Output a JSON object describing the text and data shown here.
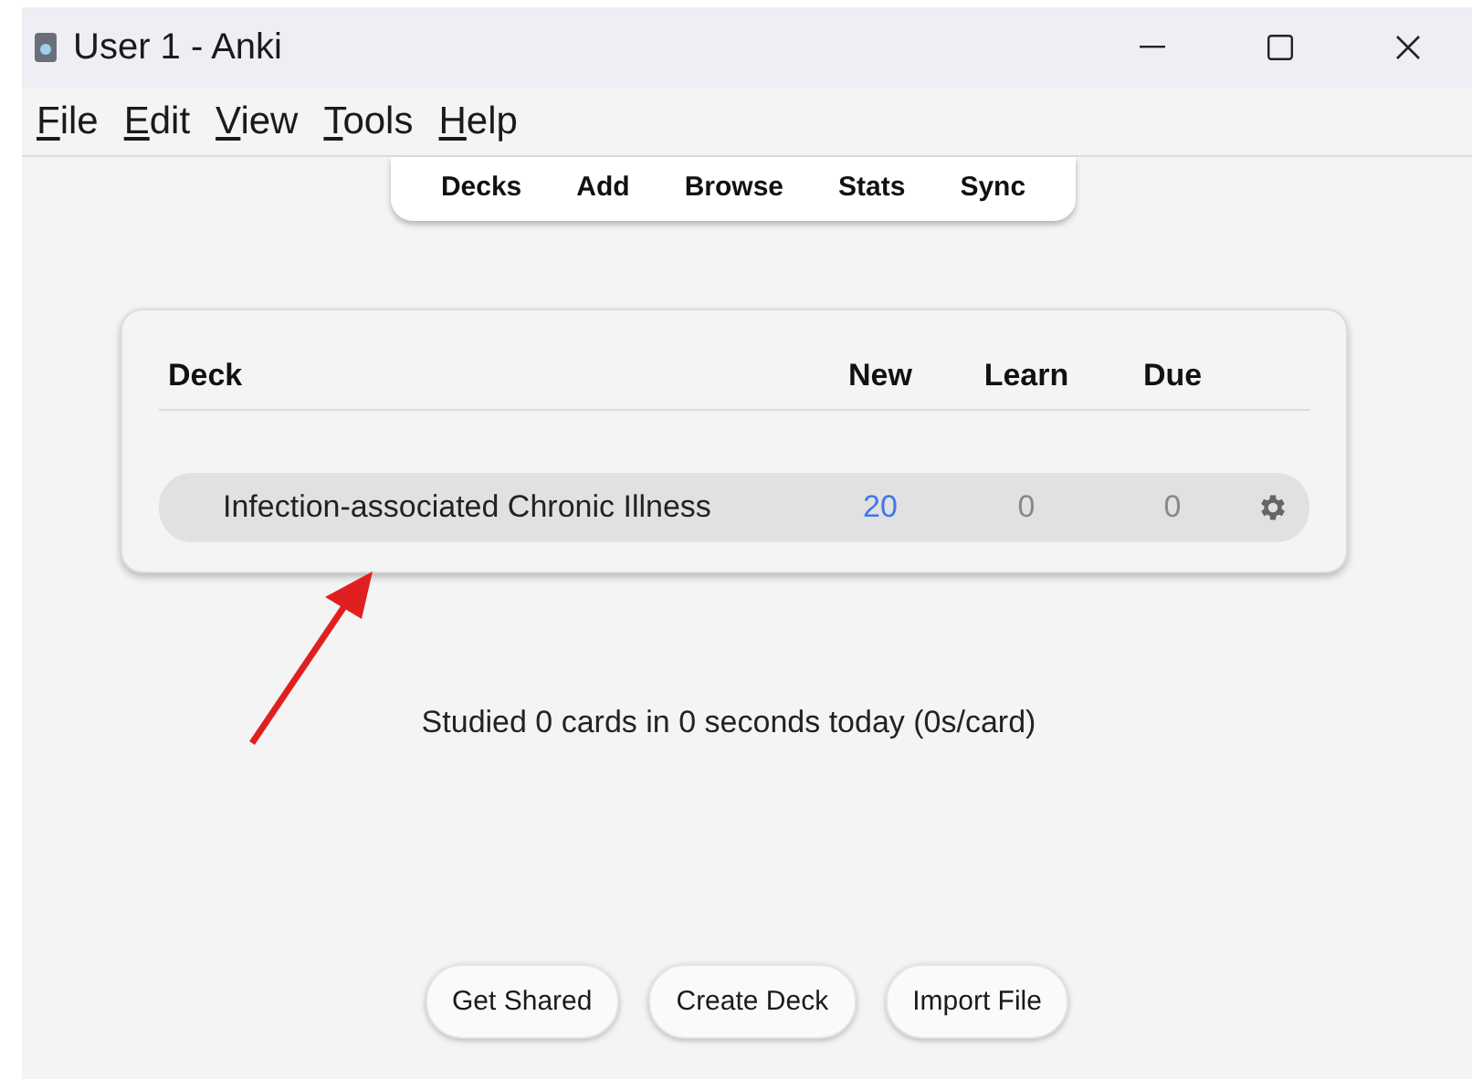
{
  "window": {
    "title": "User 1 - Anki"
  },
  "menu": [
    "File",
    "Edit",
    "View",
    "Tools",
    "Help"
  ],
  "toolbar": [
    "Decks",
    "Add",
    "Browse",
    "Stats",
    "Sync"
  ],
  "deck_table": {
    "columns": [
      "Deck",
      "New",
      "Learn",
      "Due"
    ],
    "rows": [
      {
        "name": "Infection-associated Chronic Illness",
        "counts": [
          {
            "text": "20",
            "dimmed": false
          },
          {
            "text": "0",
            "dimmed": true
          },
          {
            "text": "0",
            "dimmed": true
          }
        ]
      }
    ]
  },
  "stats": "Studied 0 cards in 0 seconds today (0s/card)",
  "buttons": [
    "Get Shared",
    "Create Deck",
    "Import File"
  ]
}
